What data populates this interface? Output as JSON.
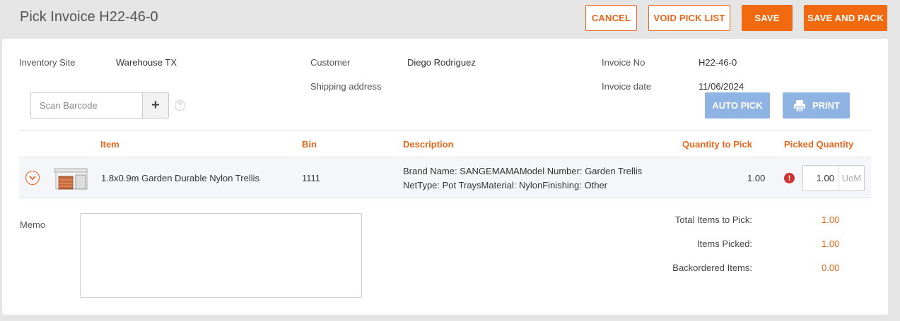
{
  "header": {
    "title": "Pick Invoice H22-46-0",
    "cancel_label": "CANCEL",
    "void_label": "VOID PICK LIST",
    "save_label": "SAVE",
    "save_pack_label": "SAVE AND PACK"
  },
  "info": {
    "inventory_site_label": "Inventory Site",
    "inventory_site_value": "Warehouse TX",
    "customer_label": "Customer",
    "customer_value": "Diego Rodriguez",
    "shipping_label": "Shipping address",
    "invoice_no_label": "Invoice No",
    "invoice_no_value": "H22-46-0",
    "invoice_date_label": "Invoice date",
    "invoice_date_value": "11/06/2024"
  },
  "scan": {
    "placeholder": "Scan Barcode",
    "add_icon": "+",
    "help_icon": "?"
  },
  "actions": {
    "auto_pick_label": "AUTO PICK",
    "print_label": "PRINT"
  },
  "table": {
    "columns": [
      "Item",
      "Bin",
      "Description",
      "Quantity to Pick",
      "Picked Quantity"
    ],
    "rows": [
      {
        "item": "1.8x0.9m Garden Durable Nylon Trellis",
        "bin": "1111",
        "description_line1": "Brand Name: SANGEMAMAModel Number: Garden Trellis",
        "description_line2": "NetType: Pot TraysMaterial: NylonFinishing: Other",
        "qty_to_pick": "1.00",
        "picked_qty": "1.00",
        "uom": "UoM",
        "error_icon": "!"
      }
    ]
  },
  "memo": {
    "label": "Memo"
  },
  "summary": {
    "total_label": "Total Items to Pick:",
    "total_value": "1.00",
    "picked_label": "Items Picked:",
    "picked_value": "1.00",
    "backordered_label": "Backordered Items:",
    "backordered_value": "0.00"
  },
  "colors": {
    "accent": "#f26a10",
    "disabled_blue": "#8fb4e4",
    "error": "#d0312d"
  }
}
